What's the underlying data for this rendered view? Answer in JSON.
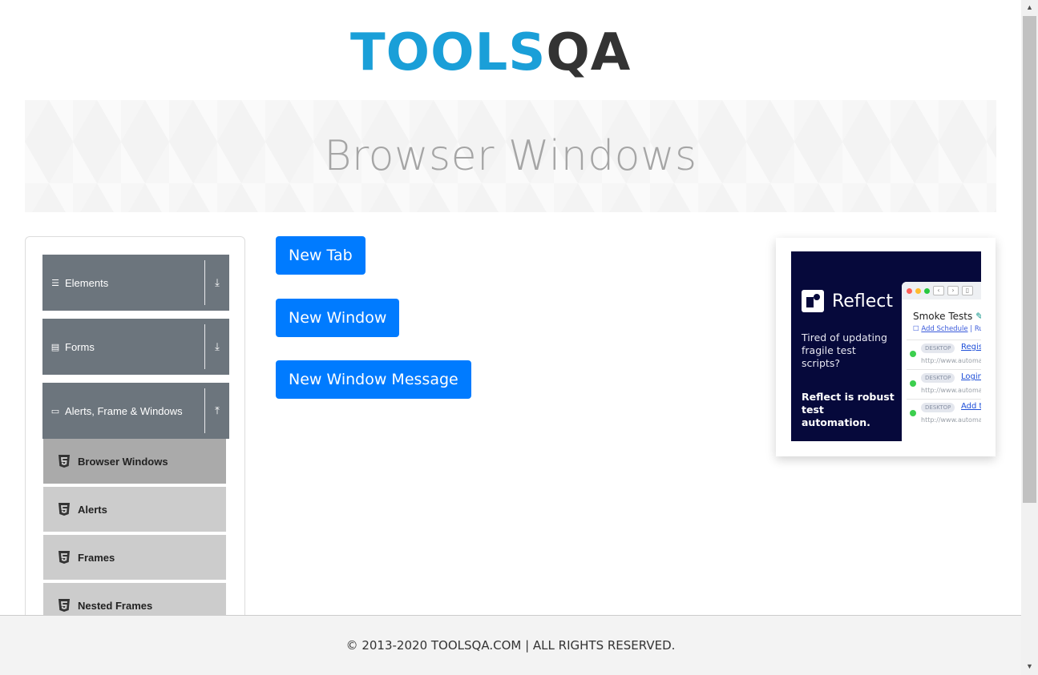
{
  "header": {
    "logo_text_tools": "TOOLS",
    "logo_text_qa": "QA"
  },
  "banner": {
    "title": "Browser Windows"
  },
  "sidebar": {
    "groups": [
      {
        "label": "Elements",
        "icon": "hamburger-icon",
        "state": "collapsed"
      },
      {
        "label": "Forms",
        "icon": "form-icon",
        "state": "collapsed"
      },
      {
        "label": "Alerts, Frame & Windows",
        "icon": "window-icon",
        "state": "expanded"
      }
    ],
    "items": [
      {
        "label": "Browser Windows",
        "active": true
      },
      {
        "label": "Alerts",
        "active": false
      },
      {
        "label": "Frames",
        "active": false
      },
      {
        "label": "Nested Frames",
        "active": false
      }
    ]
  },
  "main": {
    "buttons": [
      {
        "label": "New Tab"
      },
      {
        "label": "New Window"
      },
      {
        "label": "New Window Message"
      }
    ]
  },
  "ad": {
    "brand": "Reflect",
    "tagline": "Tired of updating fragile test scripts?",
    "tagline2": "Reflect is robust test automation.",
    "window_title": "Smoke Tests",
    "schedule_link": "Add Schedule",
    "schedule_sep": "| Ru",
    "rows": [
      {
        "tag": "DESKTOP",
        "link": "Registr",
        "url": "http://www.automat"
      },
      {
        "tag": "DESKTOP",
        "link": "Login",
        "url": "http://www.automat"
      },
      {
        "tag": "DESKTOP",
        "link": "Add to",
        "url": "http://www.automat"
      }
    ]
  },
  "footer": {
    "text": "© 2013-2020 TOOLSQA.COM | ALL RIGHTS RESERVED."
  },
  "colors": {
    "primary_button": "#007bff",
    "sidebar_group": "#6c757d",
    "menu_item": "#cccccc",
    "menu_item_active": "#aaaaaa",
    "logo_blue": "#1a9fd8"
  }
}
